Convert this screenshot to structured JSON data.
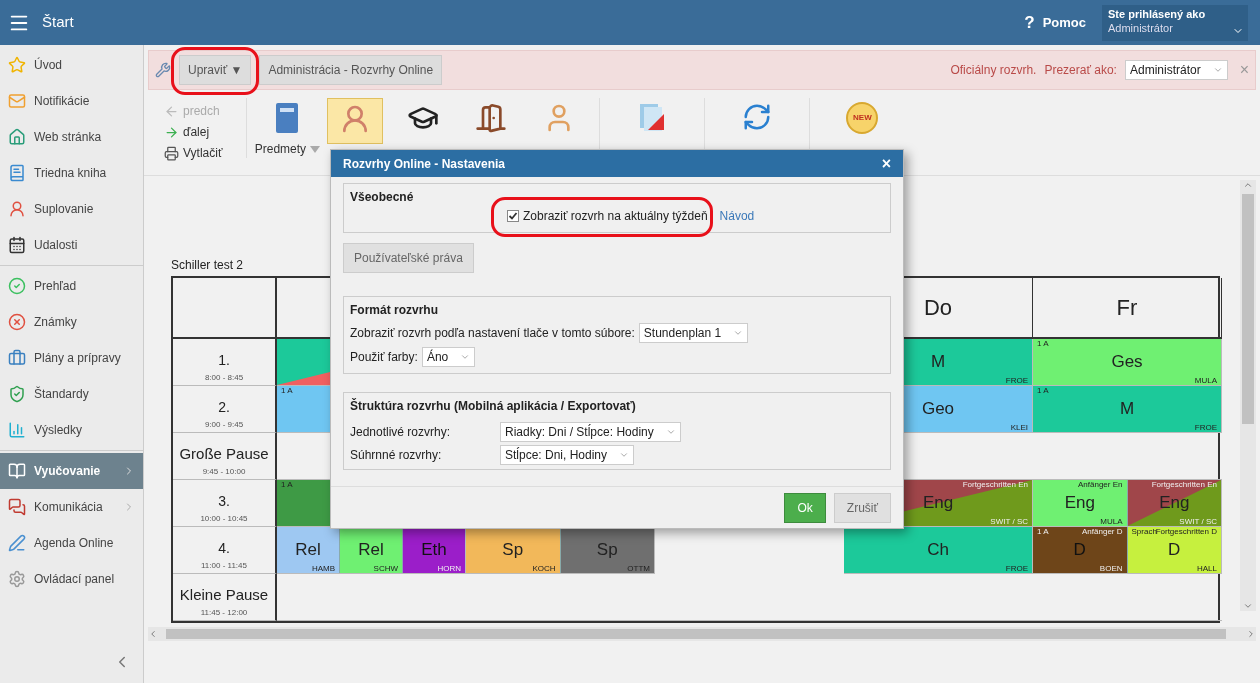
{
  "topbar": {
    "title": "Štart",
    "help_icon": "?",
    "help_label": "Pomoc",
    "user_caption": "Ste prihlásený ako",
    "user_name": "Administrátor"
  },
  "sidebar": {
    "groups": [
      [
        {
          "label": "Úvod",
          "selected": false,
          "submenu": false
        },
        {
          "label": "Notifikácie",
          "selected": false,
          "submenu": false
        },
        {
          "label": "Web stránka",
          "selected": false,
          "submenu": false
        },
        {
          "label": "Triedna kniha",
          "selected": false,
          "submenu": false
        },
        {
          "label": "Suplovanie",
          "selected": false,
          "submenu": false
        },
        {
          "label": "Udalosti",
          "selected": false,
          "submenu": false
        }
      ],
      [
        {
          "label": "Prehľad",
          "selected": false,
          "submenu": false
        },
        {
          "label": "Známky",
          "selected": false,
          "submenu": false
        },
        {
          "label": "Plány a prípravy",
          "selected": false,
          "submenu": false
        },
        {
          "label": "Štandardy",
          "selected": false,
          "submenu": false
        },
        {
          "label": "Výsledky",
          "selected": false,
          "submenu": false
        }
      ],
      [
        {
          "label": "Vyučovanie",
          "selected": true,
          "submenu": true
        },
        {
          "label": "Komunikácia",
          "selected": false,
          "submenu": true
        },
        {
          "label": "Agenda Online",
          "selected": false,
          "submenu": false
        },
        {
          "label": "Ovládací panel",
          "selected": false,
          "submenu": false
        }
      ]
    ]
  },
  "actionbar": {
    "edit_button": "Upraviť ▼",
    "admin_button": "Administrácia - Rozvrhy Online",
    "status": "Oficiálny rozvrh.",
    "view_as_label": "Prezerať ako:",
    "view_as_value": "Administrátor",
    "close": "×"
  },
  "toolbar": {
    "nav": [
      {
        "label": "predch",
        "disabled": true
      },
      {
        "label": "ďalej",
        "disabled": false
      },
      {
        "label": "Vytlačiť",
        "disabled": false
      }
    ],
    "tools": [
      {
        "label": "Predmety",
        "selected": false
      },
      {
        "selected": true
      },
      {
        "selected": false
      },
      {
        "selected": false
      },
      {
        "selected": false
      },
      {
        "selected": false
      },
      {
        "selected": false
      },
      {
        "selected": false,
        "badge": "NEW"
      }
    ]
  },
  "timetable": {
    "title": "Schiller test 2",
    "days": [
      {
        "label": "Do"
      },
      {
        "label": "Fr"
      }
    ],
    "periods": [
      {
        "kind": "lesson",
        "label": "1.",
        "time": "8:00 - 8:45",
        "day_1": [
          {
            "color": "#1cc99a",
            "lower": {
              "color": "#f06060"
            }
          }
        ],
        "day_4": [
          {
            "subject": "M",
            "teacher": "FROE",
            "color": "#1cc99a"
          }
        ],
        "day_5": [
          {
            "class": "1 A",
            "subject": "Ges",
            "teacher": "MULA",
            "color": "#6ff072"
          }
        ]
      },
      {
        "kind": "lesson",
        "label": "2.",
        "time": "9:00 - 9:45",
        "day_1": [
          {
            "class": "1 A",
            "color": "#6fc6f2"
          }
        ],
        "day_4": [
          {
            "subject": "Geo",
            "teacher": "KLEI",
            "color": "#6fc6f2"
          }
        ],
        "day_5": [
          {
            "class": "1 A",
            "subject": "M",
            "teacher": "FROE",
            "color": "#1cc99a"
          }
        ]
      },
      {
        "kind": "break",
        "label": "Große Pause",
        "time": "9:45 - 10:00"
      },
      {
        "kind": "lesson",
        "label": "3.",
        "time": "10:00 - 10:45",
        "day_1": [
          {
            "class": "1 A",
            "color": "#3e9a45"
          }
        ],
        "day_4": [
          {
            "group": "Fortgeschritten En",
            "subject": "Eng",
            "teacher": "SWIT / SC",
            "color": "#a0464a",
            "lower": {
              "color": "#6f9a1c"
            }
          }
        ],
        "day_5": [
          {
            "group": "Anfänger En",
            "subject": "Eng",
            "teacher": "MULA",
            "color": "#6ff072"
          },
          {
            "group": "Fortgeschritten En",
            "subject": "Eng",
            "teacher": "SWIT / SC",
            "color": "#a0464a",
            "lower": {
              "color": "#6f9a1c"
            }
          }
        ]
      },
      {
        "kind": "lesson",
        "label": "4.",
        "time": "11:00 - 11:45",
        "day_1": [
          {
            "subject": "Rel",
            "teacher": "HAMB",
            "color": "#9ec8f2"
          },
          {
            "subject": "Rel",
            "teacher": "SCHW",
            "color": "#6ff072"
          },
          {
            "subject": "Eth",
            "teacher": "HORN",
            "color": "#9b1ec9"
          }
        ],
        "day_2": [
          {
            "subject": "Sp",
            "teacher": "KOCH",
            "color": "#f2b85a"
          },
          {
            "subject": "Sp",
            "teacher": "OTTM",
            "color": "#6f6f6f"
          }
        ],
        "day_4": [
          {
            "subject": "Ch",
            "teacher": "FROE",
            "color": "#1cc99a"
          }
        ],
        "day_5": [
          {
            "class": "1 A",
            "group": "Anfänger D",
            "subject": "D",
            "teacher": "BOEN",
            "color": "#6e4519"
          },
          {
            "class": "Sprach",
            "group": "Fortgeschritten D",
            "subject": "D",
            "teacher": "HALL",
            "color": "#c6f03e"
          }
        ]
      },
      {
        "kind": "break",
        "label": "Kleine Pause",
        "time": "11:45 - 12:00"
      }
    ]
  },
  "dialog": {
    "title": "Rozvrhy Online - Nastavenia",
    "close": "×",
    "general": {
      "title": "Všeobecné",
      "checkbox": {
        "label": "Zobraziť rozvrh na aktuálny týždeň",
        "checked": true
      },
      "link": "Návod"
    },
    "rights_button": "Používateľské práva",
    "format": {
      "title": "Formát rozvrhu",
      "fields": [
        {
          "label": "Zobraziť rozvrh podľa nastavení tlače v tomto súbore:",
          "value": "Stundenplan 1"
        },
        {
          "label": "Použiť farby:",
          "value": "Áno"
        }
      ]
    },
    "structure": {
      "title": "Štruktúra rozvrhu (Mobilná aplikácia / Exportovať)",
      "fields": [
        {
          "label": "Jednotlivé rozvrhy:",
          "value": "Riadky: Dni / Stĺpce: Hodiny"
        },
        {
          "label": "Súhrnné rozvrhy:",
          "value": "Stĺpce: Dni, Hodiny"
        }
      ]
    },
    "ok": "Ok",
    "cancel": "Zrušiť"
  }
}
